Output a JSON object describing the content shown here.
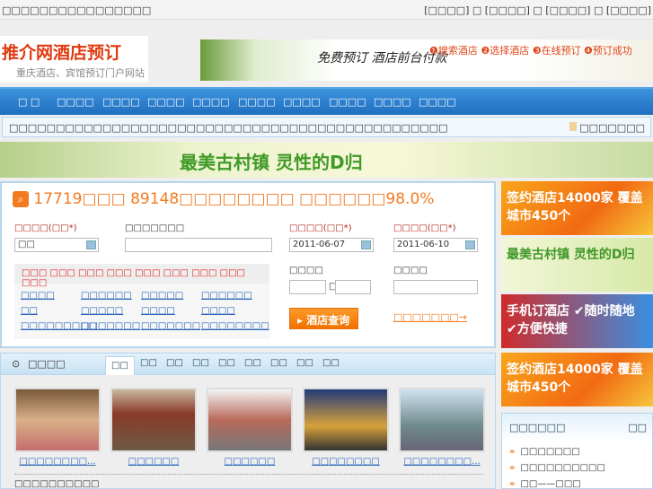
{
  "topbar": {
    "welcome": "□□□□□□□□□□□□□□□□",
    "links": "[□□□□] □ [□□□□] □ [□□□□] □ [□□□□]"
  },
  "logo": {
    "title": "推介网酒店预订",
    "subtitle": "重庆酒店、宾馆预订门户网站"
  },
  "header_banner": {
    "slogan": "免费预订 酒店前台付款",
    "steps": "❶搜索酒店 ❷选择酒店 ❸在线预订 ❹预订成功"
  },
  "nav": [
    "□ □",
    "□□□□",
    "□□□□",
    "□□□□",
    "□□□□",
    "□□□□",
    "□□□□",
    "□□□□",
    "□□□□",
    "□□□□"
  ],
  "notice": {
    "text": "□□□□□□□□□□□□□□□□□□□□□□□□□□□□□□□□□□□□□□□□□□□□□□□",
    "link": "□□□□□□□"
  },
  "mid_banner": {
    "text": "最美古村镇 灵性的D归"
  },
  "search": {
    "title": "17719□□□ 89148□□□□□□□□ □□□□□□98.0%",
    "city_label": "□□□□(□□*)",
    "city_value": "□□",
    "keyword_label": "□□□□□□□",
    "keyword_value": "",
    "checkin_label": "□□□□(□□*)",
    "checkin_value": "2011-06-07",
    "checkout_label": "□□□□(□□*)",
    "checkout_value": "2011-06-10",
    "price_label": "□□□□",
    "price_sep": "□",
    "star_label": "□□□□",
    "hot_cities": "□□□ □□□ □□□ □□□ □□□ □□□ □□□ □□□ □□□",
    "districts": [
      "□□□□",
      "□□□□□□",
      "□□□□□",
      "□□□□□□",
      "□□",
      "□□□□□",
      "□□□□",
      "□□□□",
      "□□□□□□□□□",
      "□□□□□□□",
      "□□□□□□□",
      "□□□□□□□□"
    ],
    "button": "酒店查询",
    "advanced": "□□□□□□□→"
  },
  "hotels": {
    "title": "□□□□",
    "tabs": [
      "□□",
      "□□",
      "□□",
      "□□",
      "□□",
      "□□",
      "□□",
      "□□",
      "□□"
    ],
    "items": [
      "□□□□□□□□...",
      "□□□□□□",
      "□□□□□□",
      "□□□□□□□□",
      "□□□□□□□□..."
    ],
    "footer": "□□□□□□□□□□"
  },
  "ads": [
    "签约酒店14000家 覆盖城市450个",
    "最美古村镇 灵性的D归",
    "手机订酒店 ✔随时随地 ✔方便快捷",
    "签约酒店14000家 覆盖城市450个"
  ],
  "news": {
    "title": "□□□□□□",
    "more": "□□",
    "items": [
      "□□□□□□□",
      "□□□□□□□□□□",
      "□□——□□□"
    ]
  }
}
